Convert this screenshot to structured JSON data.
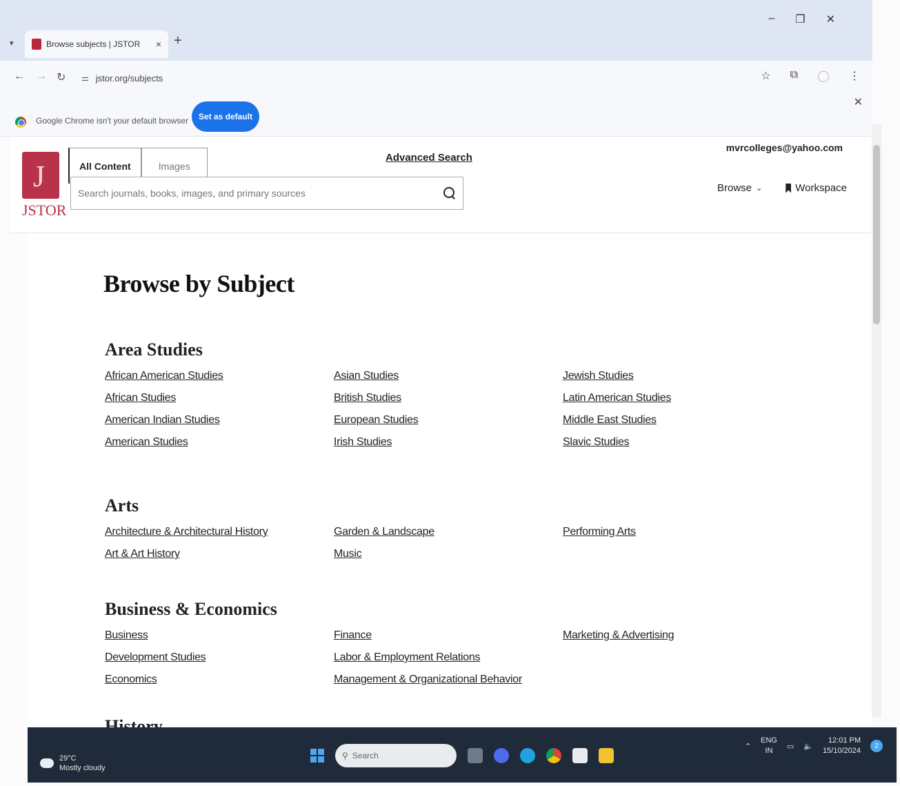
{
  "browser": {
    "tab_title": "Browse subjects | JSTOR",
    "url": "jstor.org/subjects",
    "infobar_text": "Google Chrome isn't your default browser",
    "set_default_label": "Set as default"
  },
  "header": {
    "logo_text": "JSTOR",
    "tabs": [
      {
        "label": "All Content"
      },
      {
        "label": "Images"
      }
    ],
    "search_placeholder": "Search journals, books, images, and primary sources",
    "advanced_search": "Advanced Search",
    "user_email": "mvrcolleges@yahoo.com",
    "browse_label": "Browse",
    "workspace_label": "Workspace"
  },
  "main": {
    "title": "Browse by Subject",
    "sections": [
      {
        "title": "Area Studies",
        "columns": [
          [
            "African American Studies",
            "African Studies",
            "American Indian Studies",
            "American Studies"
          ],
          [
            "Asian Studies",
            "British Studies",
            "European Studies",
            "Irish Studies"
          ],
          [
            "Jewish Studies",
            "Latin American Studies",
            "Middle East Studies",
            "Slavic Studies"
          ]
        ]
      },
      {
        "title": "Arts",
        "columns": [
          [
            "Architecture & Architectural History",
            "Art & Art History"
          ],
          [
            "Garden & Landscape",
            "Music"
          ],
          [
            "Performing Arts"
          ]
        ]
      },
      {
        "title": "Business & Economics",
        "columns": [
          [
            "Business",
            "Development Studies",
            "Economics"
          ],
          [
            "Finance",
            "Labor & Employment Relations",
            "Management & Organizational Behavior"
          ],
          [
            "Marketing & Advertising"
          ]
        ]
      },
      {
        "title": "History",
        "columns": [
          [],
          [],
          []
        ]
      }
    ]
  },
  "taskbar": {
    "temperature": "29°C",
    "weather": "Mostly cloudy",
    "search_placeholder": "Search",
    "lang_top": "ENG",
    "lang_bottom": "IN",
    "time": "12:01 PM",
    "date": "15/10/2024",
    "notification_count": "2"
  },
  "colors": {
    "brand": "#b8324a",
    "chrome_blue": "#1a73e8",
    "taskbar": "#1f2a3a"
  }
}
